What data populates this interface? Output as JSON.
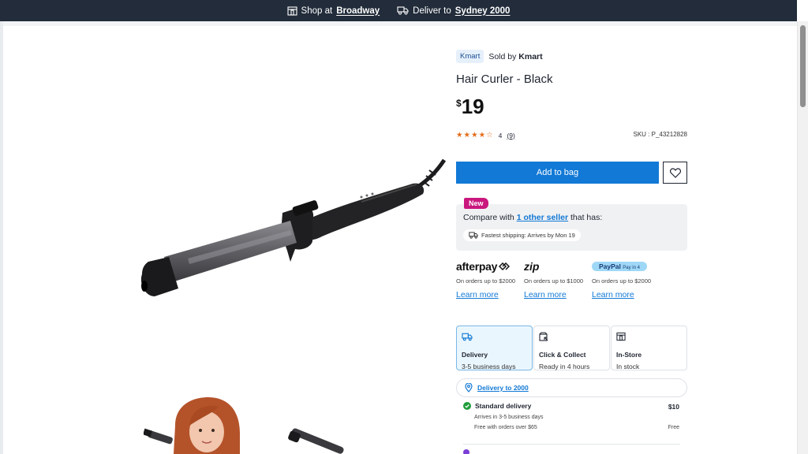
{
  "topbar": {
    "shop_prefix": "Shop at",
    "shop_store": "Broadway",
    "deliver_prefix": "Deliver to",
    "deliver_location": "Sydney 2000"
  },
  "product": {
    "seller_badge": "Kmart",
    "sold_by_prefix": "Sold by",
    "sold_by": "Kmart",
    "title": "Hair Curler - Black",
    "price_currency": "$",
    "price": "19",
    "rating": 4,
    "rating_value": "4",
    "rating_count": "(9)",
    "sku": "SKU : P_43212828",
    "add_to_bag": "Add to bag"
  },
  "compare": {
    "badge": "New",
    "prefix": "Compare with",
    "link": "1 other seller",
    "suffix": "that has:",
    "shipping": "Fastest shipping: Arrives by Mon 19"
  },
  "payments": [
    {
      "logo": "afterpay",
      "note": "On orders up to $2000",
      "learn": "Learn more"
    },
    {
      "logo": "zip",
      "note": "On orders up to $1000",
      "learn": "Learn more"
    },
    {
      "logo": "PayPal",
      "logo_sub": "Pay in 4",
      "note": "On orders up to $2000",
      "learn": "Learn more"
    }
  ],
  "fulfilment": [
    {
      "icon": "truck-icon",
      "title": "Delivery",
      "sub": "3-5 business days",
      "active": true
    },
    {
      "icon": "click-collect-icon",
      "title": "Click & Collect",
      "sub": "Ready in 4 hours",
      "active": false
    },
    {
      "icon": "store-icon",
      "title": "In-Store",
      "sub": "In stock",
      "active": false
    }
  ],
  "delivery": {
    "location_link": "Delivery to 2000",
    "standard_title": "Standard delivery",
    "standard_price": "$10",
    "standard_eta": "Arrives in 3-5 business days",
    "standard_free_note": "Free with orders over $65",
    "standard_free": "Free"
  },
  "colors": {
    "topbar": "#222c3a",
    "primary": "#1279d6",
    "new_badge": "#c9177e",
    "star": "#e36c1a",
    "success": "#1f9d3a"
  }
}
